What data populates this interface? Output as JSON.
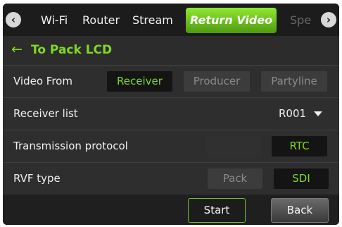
{
  "tabs": {
    "items": [
      "Wi-Fi",
      "Router",
      "Stream",
      "Return Video",
      "Spe"
    ],
    "active": "Return Video"
  },
  "header": {
    "title": "To Pack LCD"
  },
  "rows": {
    "video_from": {
      "label": "Video From",
      "options": [
        "Receiver",
        "Producer",
        "Partyline"
      ],
      "selected": "Receiver"
    },
    "receiver_list": {
      "label": "Receiver list",
      "value": "R001"
    },
    "transmission_protocol": {
      "label": "Transmission protocol",
      "option": "RTC"
    },
    "rvf_type": {
      "label": "RVF type",
      "options": [
        "Pack",
        "SDI"
      ],
      "selected": "SDI"
    }
  },
  "buttons": {
    "start": "Start",
    "back": "Back"
  },
  "colors": {
    "accent": "#7fd926",
    "active_tab": "#6cc21f"
  },
  "icons": {
    "prev": "chevron-left-icon",
    "next": "chevron-right-icon",
    "back": "arrow-left-icon",
    "dropdown": "caret-down-icon"
  }
}
